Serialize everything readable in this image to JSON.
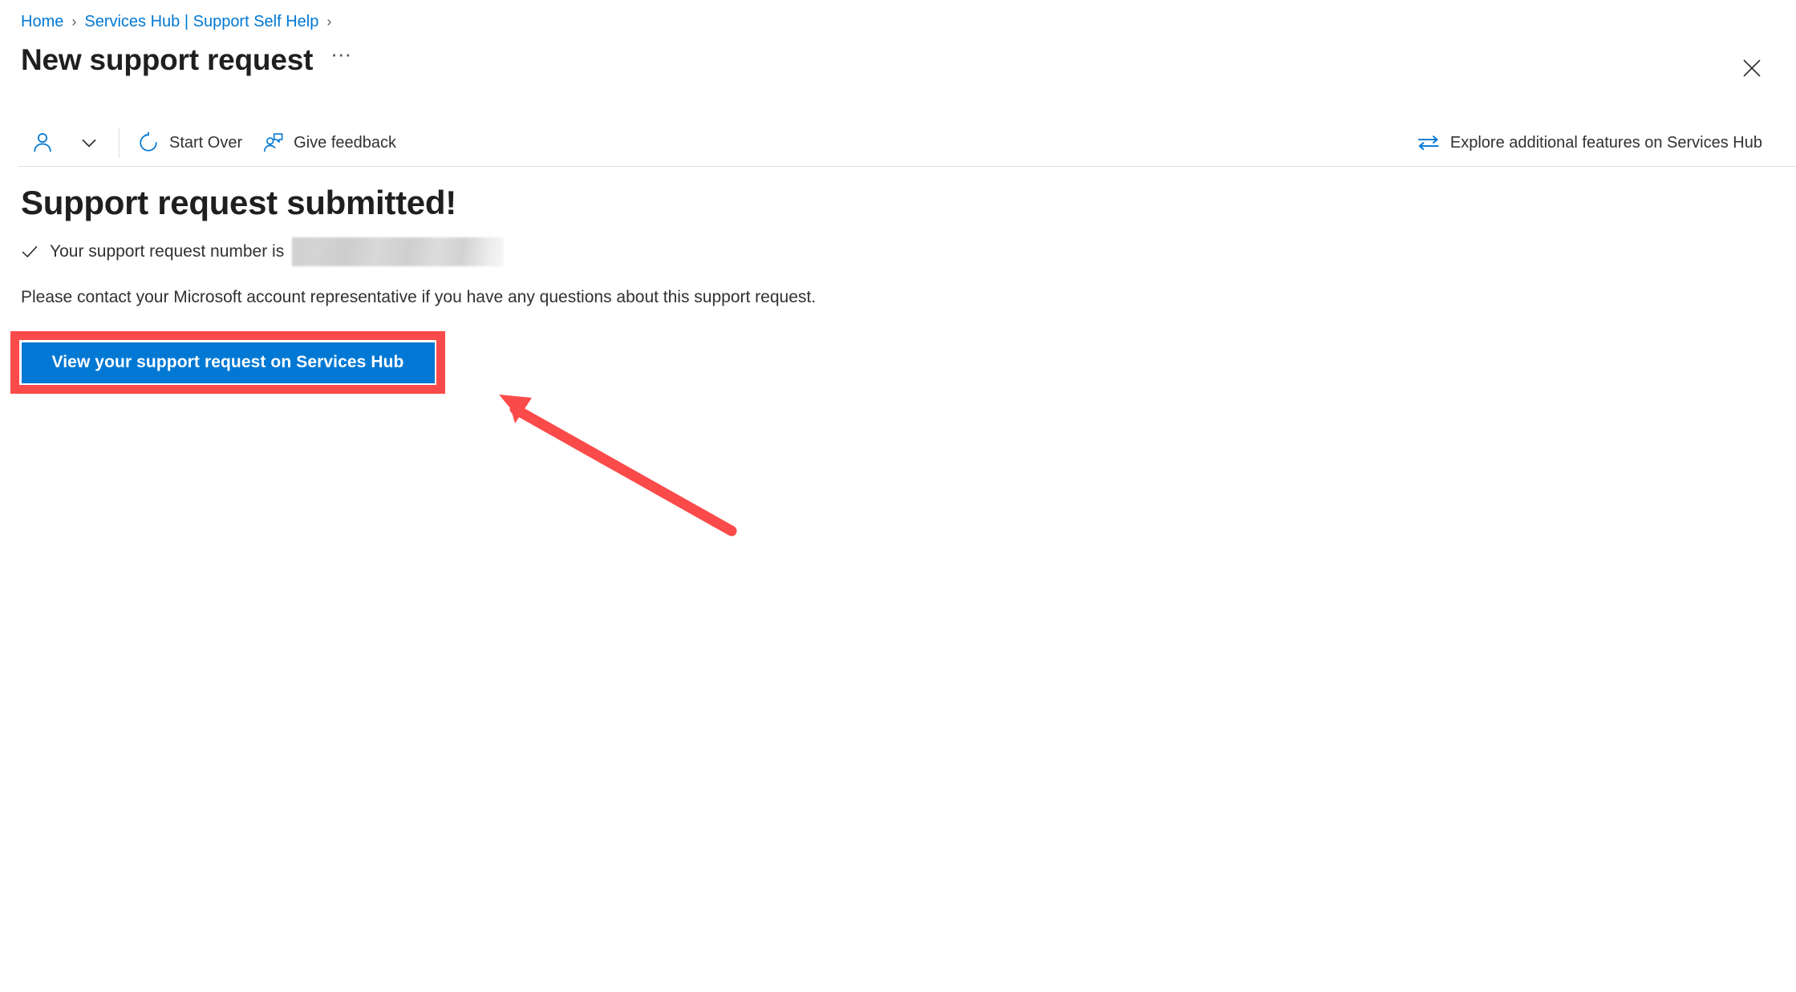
{
  "breadcrumb": {
    "items": [
      {
        "label": "Home",
        "icon": ""
      },
      {
        "label": "Services Hub | Support Self Help",
        "icon": ""
      }
    ],
    "separator": "›"
  },
  "header": {
    "title": "New support request",
    "more_label": "⋯",
    "close_icon": "close-icon"
  },
  "commandbar": {
    "account": {
      "icon": "person-icon",
      "chevron_icon": "chevron-down-icon"
    },
    "items": [
      {
        "label": "Start Over",
        "icon": "reset-circular-arrow-icon"
      },
      {
        "label": "Give feedback",
        "icon": "person-feedback-icon"
      }
    ],
    "explore": {
      "label": "Explore additional features on Services Hub",
      "icon": "swap-arrows-icon"
    }
  },
  "content": {
    "heading": "Support request submitted!",
    "status_check_icon": "checkmark-icon",
    "status_text": "Your support request number is",
    "redacted_value": "",
    "paragraph": "Please contact your Microsoft account representative if you have any questions about this support request.",
    "cta_label": "View your support request on Services Hub"
  },
  "annotations": {
    "highlight_color": "#fb4a4a",
    "arrow_color": "#fb4a4a",
    "accent_color": "#0078d4",
    "target": "view-support-request-button"
  }
}
